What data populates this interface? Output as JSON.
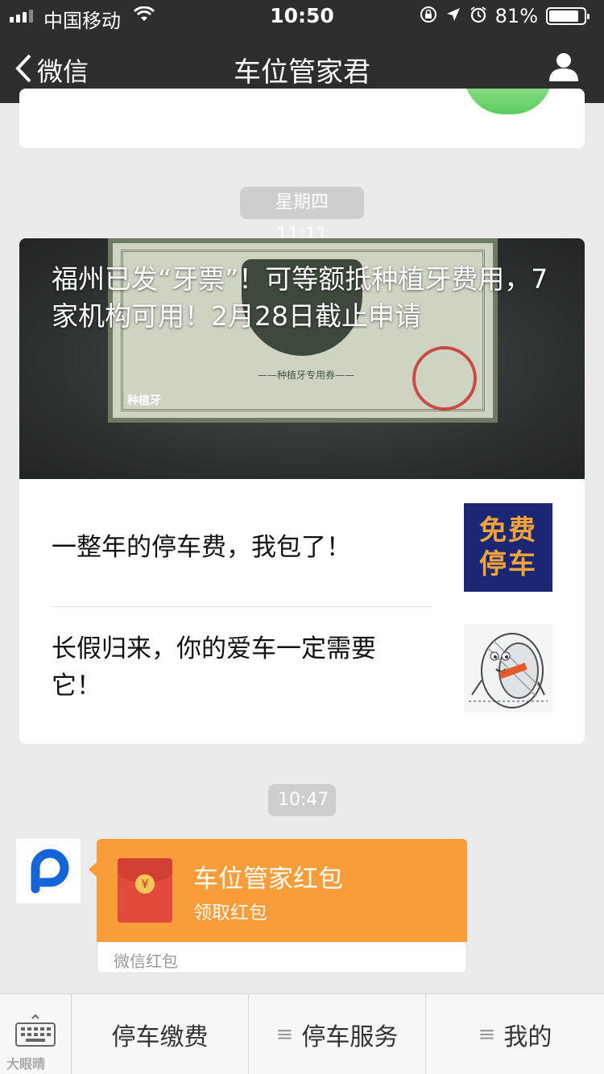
{
  "status_bar": {
    "carrier": "中国移动",
    "time": "10:50",
    "battery_percent": "81%",
    "battery_level": 0.81,
    "icons": [
      "signal-icon",
      "wifi-icon",
      "rotation-lock-icon",
      "location-icon",
      "alarm-icon",
      "battery-icon"
    ]
  },
  "nav": {
    "back_label": "微信",
    "title": "车位管家君",
    "profile_icon": "person-icon"
  },
  "messages": [
    {
      "timestamp": "星期四 11:11",
      "article": {
        "cover_title": "福州已发“牙票”！可等额抵种植牙费用，7家机构可用！2月28日截止申请",
        "cover_image_text": [
          "——种植牙专用券——",
          "种植牙"
        ],
        "items": [
          {
            "title": "一整年的停车费，我包了！",
            "thumb_text": [
              "免费",
              "停车"
            ],
            "thumb_color": "#1c2773",
            "thumb_text_color": "#f2a33a"
          },
          {
            "title": "长假归来，你的爱车一定需要它！",
            "thumb": "tire-cartoon-image"
          }
        ]
      }
    },
    {
      "timestamp": "10:47",
      "red_packet": {
        "title": "车位管家红包",
        "action": "领取红包",
        "footer": "微信红包",
        "coin_symbol": "¥",
        "color": "#f99d3a"
      }
    }
  ],
  "bottom_menu": {
    "keyboard_icon": "keyboard-icon",
    "items": [
      {
        "label": "停车缴费",
        "has_submenu": false
      },
      {
        "label": "停车服务",
        "has_submenu": true
      },
      {
        "label": "我的",
        "has_submenu": true
      }
    ]
  },
  "watermark": "大眼晴"
}
